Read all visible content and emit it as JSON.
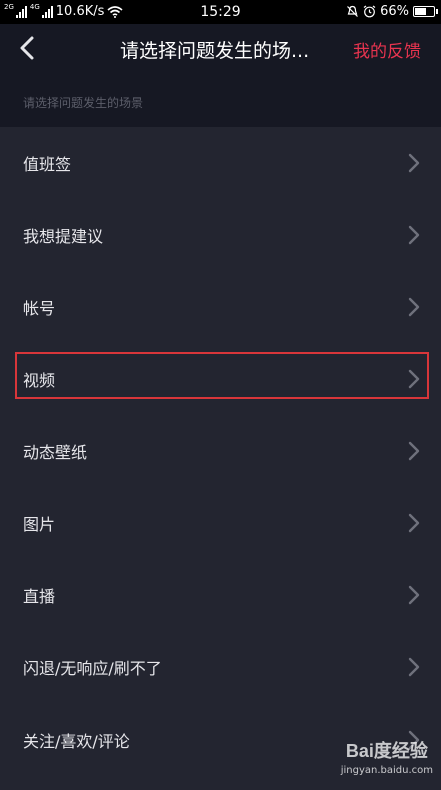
{
  "status_bar": {
    "net_tag_1": "2G",
    "net_tag_2": "4G",
    "speed": "10.6K/s",
    "time": "15:29",
    "battery": "66%",
    "battery_level": 0.66,
    "icons": [
      "signal-icon",
      "signal-icon",
      "wifi-icon",
      "mute-icon",
      "alarm-icon",
      "battery-icon"
    ]
  },
  "nav": {
    "title": "请选择问题发生的场...",
    "action": "我的反馈",
    "back_icon": "back-arrow-icon",
    "accent_color": "#e8344f"
  },
  "section_header": "请选择问题发生的场景",
  "items": [
    {
      "label": "值班签"
    },
    {
      "label": "我想提建议"
    },
    {
      "label": "帐号"
    },
    {
      "label": "视频",
      "highlighted": true
    },
    {
      "label": "动态壁纸"
    },
    {
      "label": "图片"
    },
    {
      "label": "直播"
    },
    {
      "label": "闪退/无响应/刷不了"
    },
    {
      "label": "关注/喜欢/评论"
    }
  ],
  "watermark": {
    "logo": "Bai度经验",
    "url": "jingyan.baidu.com"
  }
}
